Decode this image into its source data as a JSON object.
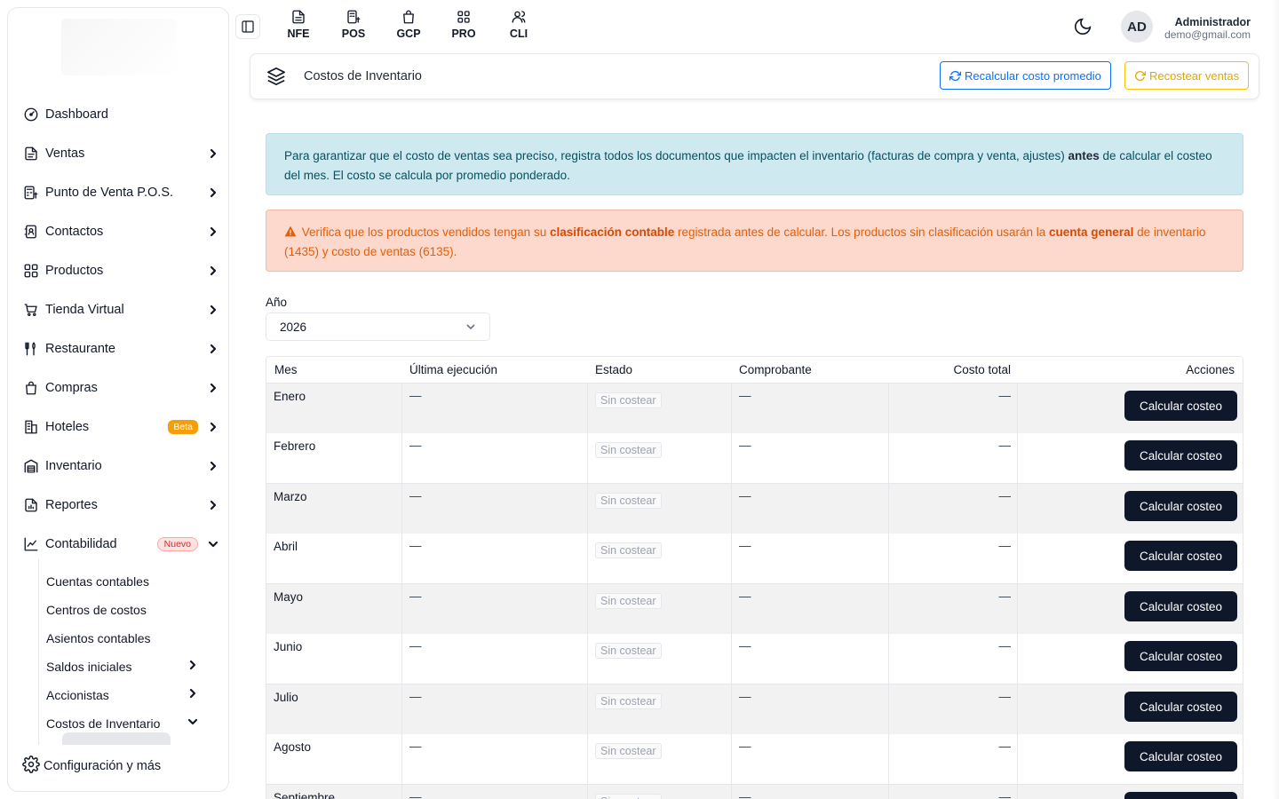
{
  "sidebar": {
    "items": [
      {
        "label": "Dashboard",
        "icon": "dashboard-icon",
        "chevron": false
      },
      {
        "label": "Ventas",
        "icon": "document-icon",
        "chevron": true
      },
      {
        "label": "Punto de Venta P.O.S.",
        "icon": "calculator-icon",
        "chevron": true
      },
      {
        "label": "Contactos",
        "icon": "contacts-icon",
        "chevron": true
      },
      {
        "label": "Productos",
        "icon": "grid-icon",
        "chevron": true
      },
      {
        "label": "Tienda Virtual",
        "icon": "cart-icon",
        "chevron": true
      },
      {
        "label": "Restaurante",
        "icon": "utensils-icon",
        "chevron": true
      },
      {
        "label": "Compras",
        "icon": "bag-icon",
        "chevron": true
      },
      {
        "label": "Hoteles",
        "icon": "building-icon",
        "chevron": true,
        "badge": "Beta"
      },
      {
        "label": "Inventario",
        "icon": "warehouse-icon",
        "chevron": true
      },
      {
        "label": "Reportes",
        "icon": "report-icon",
        "chevron": true
      },
      {
        "label": "Contabilidad",
        "icon": "chart-icon",
        "chevron": true,
        "badge": "Nuevo",
        "expanded": true
      }
    ],
    "sub_items": [
      {
        "label": "Cuentas contables",
        "chevron": false
      },
      {
        "label": "Centros de costos",
        "chevron": false
      },
      {
        "label": "Asientos contables",
        "chevron": false
      },
      {
        "label": "Saldos iniciales",
        "chevron": true
      },
      {
        "label": "Accionistas",
        "chevron": true
      },
      {
        "label": "Costos de Inventario",
        "chevron": true,
        "expanded": true
      }
    ],
    "config_label": "Configuración y más"
  },
  "topbar": {
    "apps": [
      {
        "label": "NFE",
        "icon": "file-icon"
      },
      {
        "label": "POS",
        "icon": "pos-icon"
      },
      {
        "label": "GCP",
        "icon": "shopping-bag-icon"
      },
      {
        "label": "PRO",
        "icon": "grid-apps-icon"
      },
      {
        "label": "CLI",
        "icon": "users-icon"
      }
    ],
    "avatar_initials": "AD",
    "user_name": "Administrador",
    "user_email": "demo@gmail.com"
  },
  "header": {
    "title": "Costos de Inventario",
    "btn_recalcular": "Recalcular costo promedio",
    "btn_recostear": "Recostear ventas"
  },
  "alerts": {
    "info_pre": "Para garantizar que el costo de ventas sea preciso, registra todos los documentos que impacten el inventario (facturas de compra y venta, ajustes)",
    "info_bold": "antes",
    "info_post": "de calcular el costeo del mes. El costo se calcula por promedio ponderado.",
    "warn_1": "Verifica que los productos vendidos tengan su",
    "warn_bold_1": "clasificación contable",
    "warn_2": "registrada antes de calcular. Los productos sin clasificación usarán la",
    "warn_bold_2": "cuenta general",
    "warn_3": "de inventario (1435) y costo de ventas (6135)."
  },
  "filter": {
    "year_label": "Año",
    "year_value": "2026"
  },
  "table": {
    "headers": {
      "mes": "Mes",
      "ultima": "Última ejecución",
      "estado": "Estado",
      "comprobante": "Comprobante",
      "costo": "Costo total",
      "acciones": "Acciones"
    },
    "dash": "—",
    "status": "Sin costear",
    "action_label": "Calcular costeo",
    "rows": [
      {
        "mes": "Enero"
      },
      {
        "mes": "Febrero"
      },
      {
        "mes": "Marzo"
      },
      {
        "mes": "Abril"
      },
      {
        "mes": "Mayo"
      },
      {
        "mes": "Junio"
      },
      {
        "mes": "Julio"
      },
      {
        "mes": "Agosto"
      },
      {
        "mes": "Septiembre"
      }
    ]
  }
}
